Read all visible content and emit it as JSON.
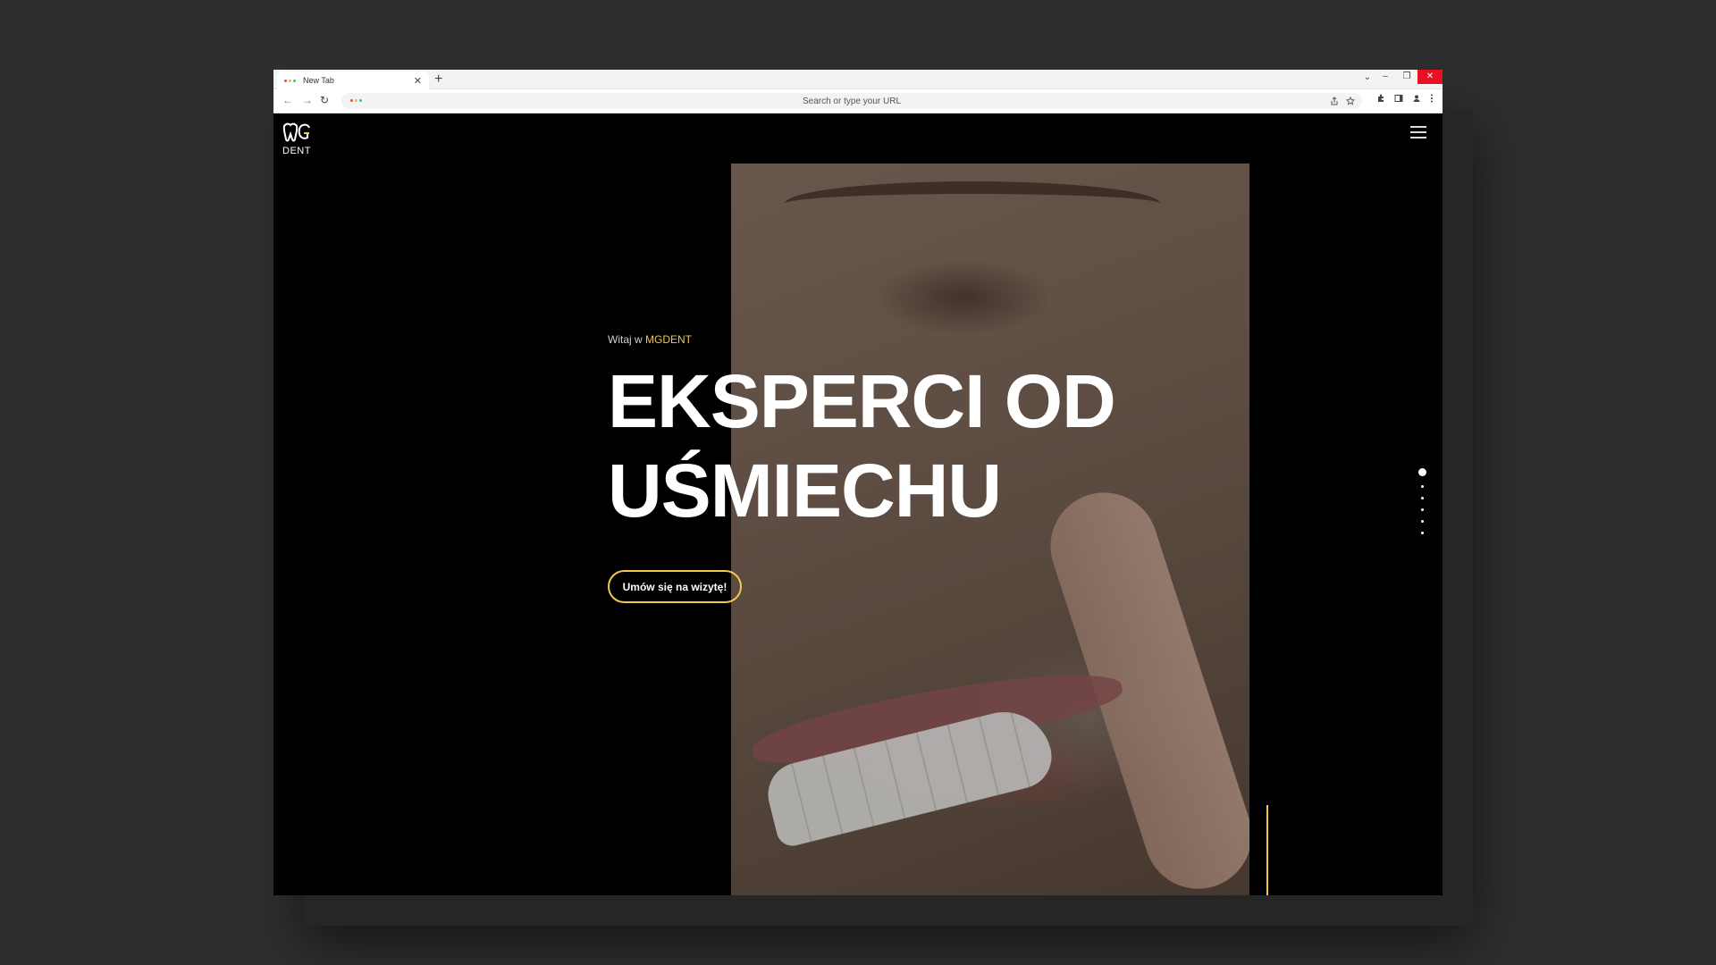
{
  "browser": {
    "tab_title": "New Tab",
    "tab_close": "✕",
    "new_tab": "+",
    "tab_list": "⌄",
    "win_min": "–",
    "win_max": "❐",
    "win_close": "✕",
    "back": "←",
    "forward": "→",
    "reload": "↻",
    "address_placeholder": "Search or type your URL",
    "icons": [
      "share-icon",
      "star-icon",
      "extensions-icon",
      "sidepanel-icon",
      "profile-icon",
      "menu-icon"
    ]
  },
  "site": {
    "logo_text": "DENT",
    "welcome_prefix": "Witaj w ",
    "welcome_brand": "MGDENT",
    "headline_line1": "EKSPERCI OD",
    "headline_line2": "UŚMIECHU",
    "cta_label": "Umów się na wizytę!",
    "slider": {
      "total": 6,
      "active_index": 0
    }
  },
  "colors": {
    "accent": "#f2c94c",
    "background": "#000000",
    "canvas": "#2e2e2e"
  }
}
